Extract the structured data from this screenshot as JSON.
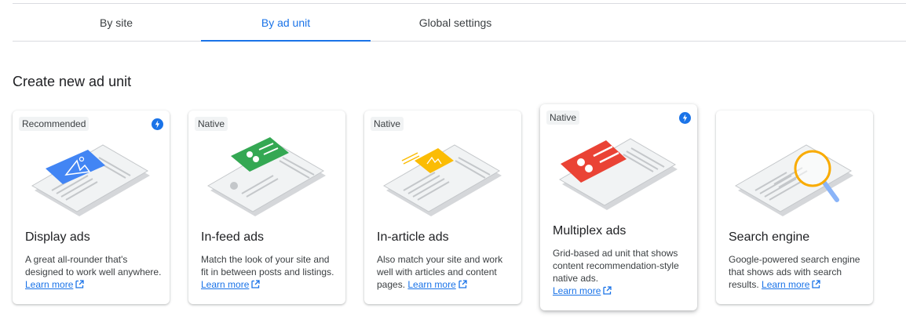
{
  "tabs": [
    {
      "label": "By site",
      "active": false
    },
    {
      "label": "By ad unit",
      "active": true
    },
    {
      "label": "Global settings",
      "active": false
    }
  ],
  "section_title": "Create new ad unit",
  "learn_more": "Learn more",
  "accent_color": "#1a73e8",
  "cards": [
    {
      "badge": "Recommended",
      "boosted": true,
      "title": "Display ads",
      "desc": "A great all-rounder that's designed to work well anywhere.",
      "icon": "display-ads-illustration"
    },
    {
      "badge": "Native",
      "boosted": false,
      "title": "In-feed ads",
      "desc": "Match the look of your site and fit in between posts and listings.",
      "icon": "in-feed-ads-illustration"
    },
    {
      "badge": "Native",
      "boosted": false,
      "title": "In-article ads",
      "desc": "Also match your site and work well with articles and content pages.",
      "icon": "in-article-ads-illustration"
    },
    {
      "badge": "Native",
      "boosted": true,
      "title": "Multiplex ads",
      "desc": "Grid-based ad unit that shows content recommendation-style native ads.",
      "icon": "multiplex-ads-illustration"
    },
    {
      "badge": "",
      "boosted": false,
      "title": "Search engine",
      "desc": "Google-powered search engine that shows ads with search results.",
      "icon": "search-engine-illustration"
    }
  ]
}
